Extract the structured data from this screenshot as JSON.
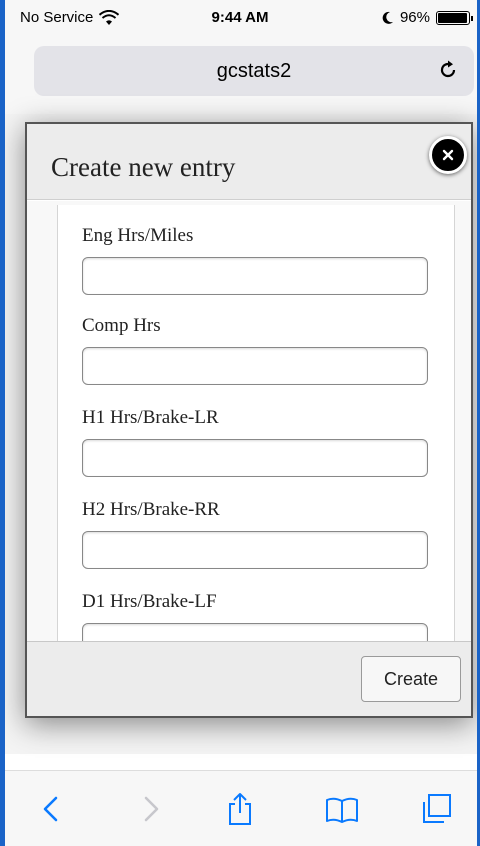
{
  "status_bar": {
    "carrier": "No Service",
    "time": "9:44 AM",
    "battery": "96%",
    "battery_level": 0.96
  },
  "address_bar": {
    "url": "gcstats2"
  },
  "dialog": {
    "title": "Create new entry",
    "fields": [
      {
        "label": "Eng Hrs/Miles",
        "value": ""
      },
      {
        "label": "Comp Hrs",
        "value": ""
      },
      {
        "label": "H1 Hrs/Brake-LR",
        "value": ""
      },
      {
        "label": "H2 Hrs/Brake-RR",
        "value": ""
      },
      {
        "label": "D1 Hrs/Brake-LF",
        "value": ""
      }
    ],
    "create_label": "Create"
  },
  "colors": {
    "accent": "#1a63c7",
    "safari_blue": "#0a7aff"
  },
  "icons": {
    "status": [
      "wifi-icon",
      "moon-icon",
      "battery-icon"
    ],
    "address": [
      "reload-icon"
    ],
    "dialog": [
      "close-icon"
    ],
    "toolbar": [
      "back-icon",
      "forward-icon",
      "share-icon",
      "bookmarks-icon",
      "tabs-icon"
    ]
  }
}
